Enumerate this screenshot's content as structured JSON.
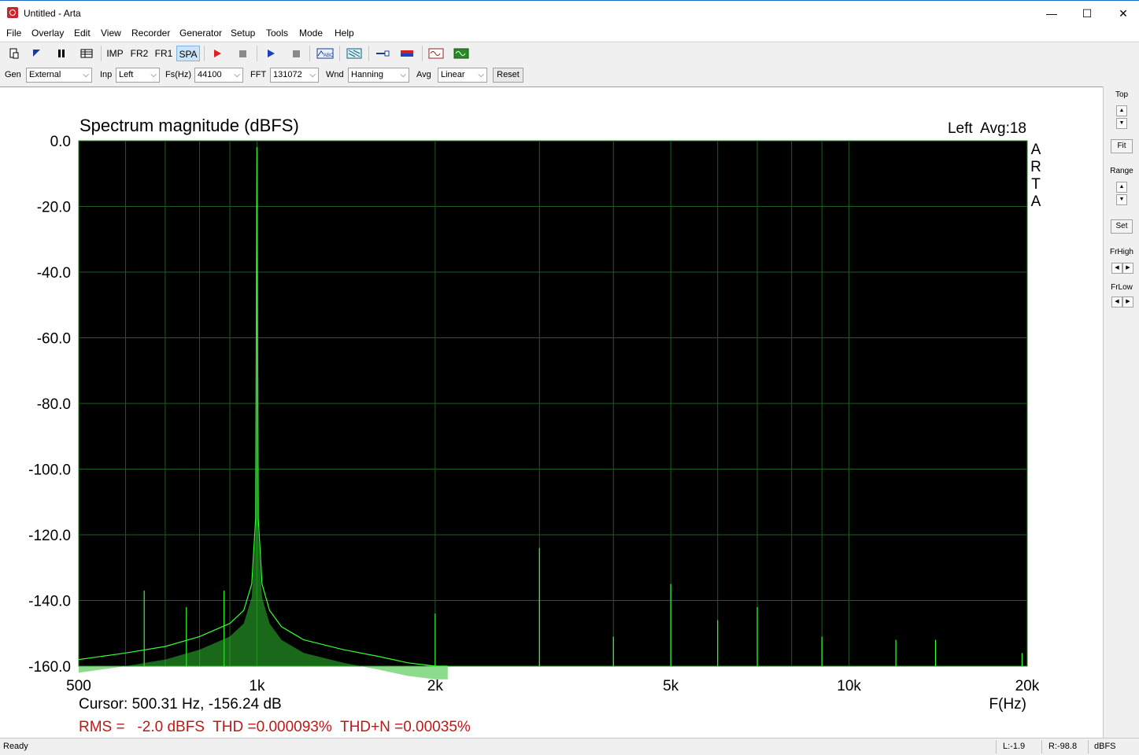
{
  "window": {
    "title": "Untitled - Arta",
    "minimize": "—",
    "maximize": "☐",
    "close": "✕"
  },
  "menu": [
    "File",
    "Overlay",
    "Edit",
    "View",
    "Recorder",
    "Generator",
    "Setup",
    "Tools",
    "Mode",
    "Help"
  ],
  "toolbar": {
    "imp": "IMP",
    "fr2": "FR2",
    "fr1": "FR1",
    "spa": "SPA",
    "icons": [
      "new-icon",
      "open-icon",
      "pause-icon",
      "table-icon",
      "record-icon",
      "stop-icon",
      "play-icon",
      "stop2-icon",
      "abc-icon",
      "waterfall-icon",
      "cursor-icon",
      "bars-icon",
      "sine-icon",
      "wave-icon"
    ]
  },
  "controls": {
    "gen_label": "Gen",
    "gen_value": "External",
    "inp_label": "Inp",
    "inp_value": "Left",
    "fs_label": "Fs(Hz)",
    "fs_value": "44100",
    "fft_label": "FFT",
    "fft_value": "131072",
    "wnd_label": "Wnd",
    "wnd_value": "Hanning",
    "avg_label": "Avg",
    "avg_value": "Linear",
    "reset_label": "Reset"
  },
  "side": {
    "top": "Top",
    "fit": "Fit",
    "range": "Range",
    "set": "Set",
    "frhigh": "FrHigh",
    "frlow": "FrLow"
  },
  "plot": {
    "title": "Spectrum magnitude (dBFS)",
    "channel_info": "Left  Avg:18",
    "watermark": [
      "A",
      "R",
      "T",
      "A"
    ],
    "cursor": "Cursor: 500.31 Hz, -156.24 dB",
    "xunit": "F(Hz)",
    "metrics": "RMS =   -2.0 dBFS  THD =0.000093%  THD+N =0.00035%"
  },
  "chart_data": {
    "type": "line",
    "title": "Spectrum magnitude (dBFS)",
    "xlabel": "F(Hz)",
    "ylabel": "",
    "x_scale": "log",
    "xlim": [
      500,
      20000
    ],
    "ylim": [
      -160,
      0
    ],
    "grid": true,
    "yticks": [
      "0.0",
      "-20.0",
      "-40.0",
      "-60.0",
      "-80.0",
      "-100.0",
      "-120.0",
      "-140.0",
      "-160.0"
    ],
    "xticks": [
      "500",
      "1k",
      "2k",
      "5k",
      "10k",
      "20k"
    ],
    "xtick_values": [
      500,
      1000,
      2000,
      5000,
      10000,
      20000
    ],
    "colors": {
      "background": "#000000",
      "grid": "#1f5c1f",
      "trace": "#33ff33"
    },
    "series": [
      {
        "x": [
          500,
          600,
          700,
          800,
          900,
          950,
          980,
          995,
          1000,
          1005,
          1020,
          1050,
          1100,
          1200,
          1400,
          1600,
          1800,
          2000,
          2100
        ],
        "values": [
          -158,
          -156,
          -154,
          -151,
          -147,
          -143,
          -135,
          -115,
          -2,
          -115,
          -135,
          -143,
          -148,
          -152,
          -155,
          -157,
          -159,
          -160,
          -160
        ]
      }
    ],
    "spurs": [
      {
        "x": 645,
        "y": -137
      },
      {
        "x": 760,
        "y": -142
      },
      {
        "x": 880,
        "y": -137
      },
      {
        "x": 2000,
        "y": -144
      },
      {
        "x": 3000,
        "y": -124
      },
      {
        "x": 4000,
        "y": -151
      },
      {
        "x": 5000,
        "y": -135
      },
      {
        "x": 6000,
        "y": -146
      },
      {
        "x": 7000,
        "y": -142
      },
      {
        "x": 9000,
        "y": -151
      },
      {
        "x": 12000,
        "y": -152
      },
      {
        "x": 14000,
        "y": -152
      },
      {
        "x": 19600,
        "y": -156
      }
    ]
  },
  "status": {
    "ready": "Ready",
    "l": "L:-1.9",
    "r": "R:-98.8",
    "unit": "dBFS"
  }
}
